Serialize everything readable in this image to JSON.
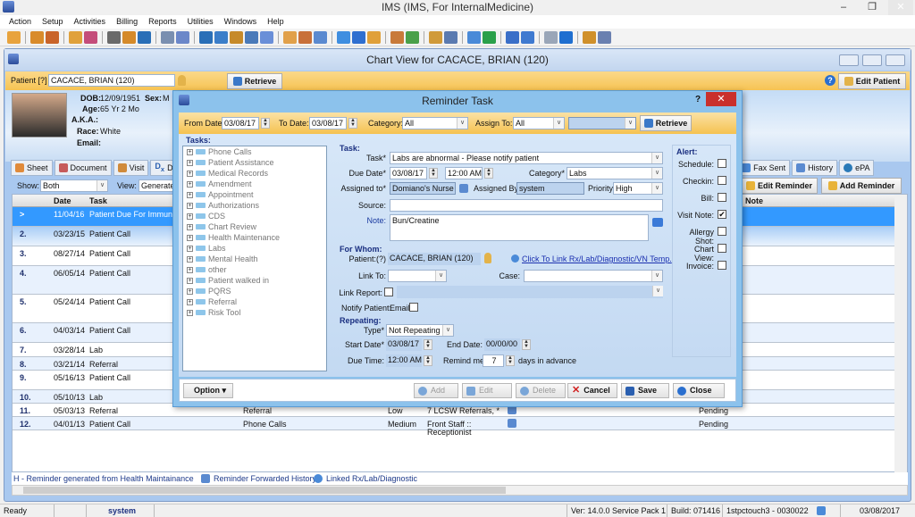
{
  "app": {
    "title": "IMS (IMS, For InternalMedicine)",
    "window_controls": {
      "minimize": "–",
      "restore": "❐",
      "close": "✕"
    }
  },
  "menu": [
    "Action",
    "Setup",
    "Activities",
    "Billing",
    "Reports",
    "Utilities",
    "Windows",
    "Help"
  ],
  "toolbar_icon_colors": [
    "#e8a33d",
    "#d98b2b",
    "#c9642a",
    "#e0a13b",
    "#c44d7a",
    "#6a6a6a",
    "#d58a2a",
    "#2a6fb7",
    "#7a8fb0",
    "#6b87c9",
    "#2a6fb7",
    "#3b7ec9",
    "#c68a2a",
    "#4a7ab9",
    "#6a8fd8",
    "#e1a04a",
    "#c8703a",
    "#5b8ad0",
    "#3f8ee0",
    "#2f6fd0",
    "#e0a03a",
    "#c87a3a",
    "#4aa04a",
    "#d09a3a",
    "#5a7ab0",
    "#4a8ad8",
    "#2aa04a",
    "#3a6fc8",
    "#3f7ad0",
    "#9aa6b8",
    "#1f6fd0",
    "#d0902a",
    "#6a80b0"
  ],
  "chart_view": {
    "title": "Chart View for CACACE, BRIAN  (120)",
    "patient_label": "Patient [?]",
    "patient_value": "CACACE, BRIAN  (120)",
    "retrieve_label": "Retrieve",
    "edit_patient_label": "Edit Patient",
    "demographics": {
      "dob_label": "DOB:",
      "dob": "12/09/1951",
      "sex_label": "Sex:",
      "sex": "M",
      "age_label": "Age:",
      "age": "65 Yr 2 Mo",
      "aka_label": "A.K.A.:",
      "aka": "",
      "race_label": "Race:",
      "race": "White",
      "email_label": "Email:",
      "email": ""
    },
    "tabs": [
      {
        "label": "Sheet"
      },
      {
        "label": "Document"
      },
      {
        "label": "Visit"
      },
      {
        "label": "Dx"
      },
      {
        "label": "Fax Sent"
      },
      {
        "label": "History"
      },
      {
        "label": "ePA"
      }
    ],
    "show_label": "Show:",
    "show_value": "Both",
    "view_label": "View:",
    "view_value": "Generated",
    "edit_reminder_label": "Edit Reminder",
    "add_reminder_label": "Add Reminder",
    "grid": {
      "columns": {
        "date": "Date",
        "task": "Task",
        "note": "Note"
      },
      "rows": [
        {
          "num": ">",
          "date": "11/04/16",
          "task": "Patient Due For Immunizatio"
        },
        {
          "num": "2.",
          "date": "03/23/15",
          "task": "Patient Call"
        },
        {
          "num": "3.",
          "date": "08/27/14",
          "task": "Patient Call"
        },
        {
          "num": "4.",
          "date": "06/05/14",
          "task": "Patient Call"
        },
        {
          "num": "5.",
          "date": "05/24/14",
          "task": "Patient Call"
        },
        {
          "num": "6.",
          "date": "04/03/14",
          "task": "Patient Call"
        },
        {
          "num": "7.",
          "date": "03/28/14",
          "task": "Lab"
        },
        {
          "num": "8.",
          "date": "03/21/14",
          "task": "Referral"
        },
        {
          "num": "9.",
          "date": "05/16/13",
          "task": "Patient Call"
        },
        {
          "num": "10.",
          "date": "05/10/13",
          "task": "Lab"
        },
        {
          "num": "11.",
          "date": "05/03/13",
          "task": "Referral",
          "category": "Referral",
          "priority": "Low",
          "assigned": "7 LCSW Referrals, *",
          "status": "Pending"
        },
        {
          "num": "12.",
          "date": "04/01/13",
          "task": "Patient Call",
          "category": "Phone Calls",
          "priority": "Medium",
          "assigned": "Front Staff ::",
          "assigned2": "Receptionist",
          "status": "Pending"
        }
      ]
    },
    "legend": {
      "h": "H -  Reminder generated from Health Maintainance",
      "forwarded": "Reminder Forwarded History",
      "linked": "Linked Rx/Lab/Diagnostic"
    }
  },
  "dialog": {
    "title": "Reminder Task",
    "help": "?",
    "close": "✕",
    "filter": {
      "from_label": "From Date:",
      "from_value": "03/08/17",
      "to_label": "To Date:",
      "to_value": "03/08/17",
      "category_label": "Category:",
      "category_value": "All",
      "assign_label": "Assign To:",
      "assign_value": "All",
      "assign_extra": "",
      "retrieve_label": "Retrieve"
    },
    "tasks_heading": "Tasks:",
    "task_tree": [
      "Phone Calls",
      "Patient Assistance",
      "Medical Records",
      "Amendment",
      "Appointment",
      "Authorizations",
      "CDS",
      "Chart Review",
      "Health Maintenance",
      "Labs",
      "Mental Health",
      "other",
      "Patient walked in",
      "PQRS",
      "Referral",
      "Risk Tool"
    ],
    "task_section": {
      "heading": "Task:",
      "task_label": "Task*",
      "task_value": "Labs are abnormal - Please notify patient",
      "due_label": "Due Date*",
      "due_date": "03/08/17",
      "due_time": "12:00 AM",
      "category_label": "Category*",
      "category_value": "Labs",
      "assigned_to_label": "Assigned to*",
      "assigned_to": "Domiano's Nurse",
      "assigned_by_label": "Assigned By:",
      "assigned_by": "system",
      "priority_label": "Priority:",
      "priority_value": "High",
      "source_label": "Source:",
      "source_value": "",
      "note_label": "Note:",
      "note_value": "Bun/Creatine"
    },
    "for_whom": {
      "heading": "For Whom:",
      "patient_label": "Patient:(?)",
      "patient_value": "CACACE, BRIAN  (120)",
      "link_text": "Click To Link Rx/Lab/Diagnostic/VN Temp.",
      "link_to_label": "Link To:",
      "link_to_value": "",
      "case_label": "Case:",
      "case_value": "",
      "link_report_label": "Link Report:",
      "link_report_checked": false,
      "notify_label": "Notify Patient:",
      "email_label": "Email",
      "email_checked": false
    },
    "repeating": {
      "heading": "Repeating:",
      "type_label": "Type*",
      "type_value": "Not Repeating",
      "start_label": "Start Date*",
      "start_value": "03/08/17",
      "end_label": "End Date:",
      "end_value": "00/00/00",
      "due_time_label": "Due Time:",
      "due_time_value": "12:00 AM",
      "remind_label": "Remind me:",
      "remind_value": "7",
      "days_label": "days in advance"
    },
    "alert": {
      "heading": "Alert:",
      "items": [
        {
          "label": "Schedule:",
          "checked": false
        },
        {
          "label": "Checkin:",
          "checked": false
        },
        {
          "label": "Bill:",
          "checked": false
        },
        {
          "label": "Visit Note:",
          "checked": true
        },
        {
          "label": "Allergy Shot:",
          "checked": false
        },
        {
          "label": "Chart View:",
          "checked": false
        },
        {
          "label": "Invoice:",
          "checked": false
        }
      ]
    },
    "footer": {
      "option": "Option ▾",
      "add": "Add",
      "edit": "Edit",
      "delete": "Delete",
      "cancel": "Cancel",
      "save": "Save",
      "close": "Close"
    }
  },
  "statusbar": {
    "ready": "Ready",
    "user": "system",
    "version": "Ver: 14.0.0 Service Pack 1",
    "build": "Build: 071416",
    "server": "1stpctouch3 - 0030022",
    "date": "03/08/2017"
  },
  "colors": {
    "accent_orange": "#f6c353",
    "selection_blue": "#3399ff",
    "dialog_frame": "#8cc2ec",
    "close_red": "#c9302c"
  }
}
